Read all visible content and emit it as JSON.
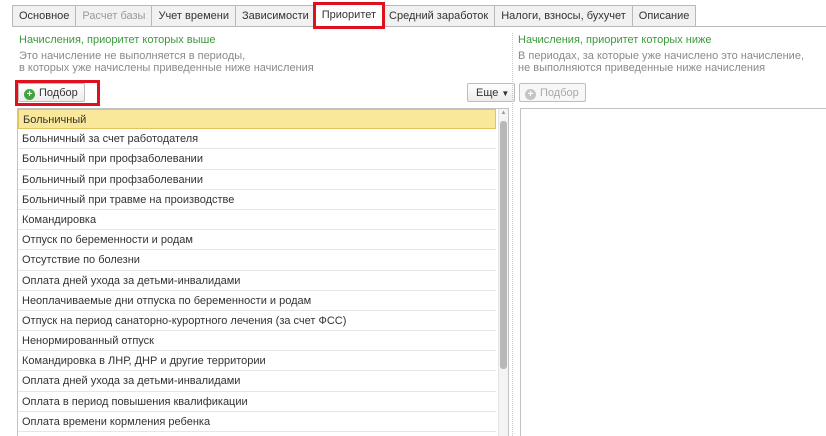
{
  "tabs": [
    {
      "label": "Основное",
      "state": "normal"
    },
    {
      "label": "Расчет базы",
      "state": "disabled"
    },
    {
      "label": "Учет времени",
      "state": "normal"
    },
    {
      "label": "Зависимости",
      "state": "normal"
    },
    {
      "label": "Приоритет",
      "state": "active"
    },
    {
      "label": "Средний заработок",
      "state": "normal"
    },
    {
      "label": "Налоги, взносы, бухучет",
      "state": "normal"
    },
    {
      "label": "Описание",
      "state": "normal"
    }
  ],
  "left": {
    "title": "Начисления, приоритет которых выше",
    "desc_line1": "Это начисление не выполняется в периоды,",
    "desc_line2": "в которых уже начислены приведенные ниже начисления",
    "add_button": "Подбор",
    "more_button": "Еще",
    "items": [
      "Больничный",
      "Больничный за счет работодателя",
      "Больничный при профзаболевании",
      "Больничный при профзаболевании",
      "Больничный при травме на производстве",
      "Командировка",
      "Отпуск по беременности и родам",
      "Отсутствие по болезни",
      "Оплата дней ухода за детьми-инвалидами",
      "Неоплачиваемые дни отпуска по беременности и родам",
      "Отпуск на период санаторно-курортного лечения (за счет ФСС)",
      "Ненормированный отпуск",
      "Командировка в ЛНР, ДНР и другие территории",
      "Оплата дней ухода за детьми-инвалидами",
      "Оплата в период повышения квалификации",
      "Оплата времени кормления ребенка"
    ]
  },
  "right": {
    "title": "Начисления, приоритет которых ниже",
    "desc_line1": "В периодах, за которые уже начислено это начисление,",
    "desc_line2": "не выполняются приведенные ниже начисления",
    "add_button": "Подбор"
  },
  "colors": {
    "accent_green": "#3a9a3a",
    "highlight_red": "#e0101d",
    "selection": "#f9e89a"
  }
}
